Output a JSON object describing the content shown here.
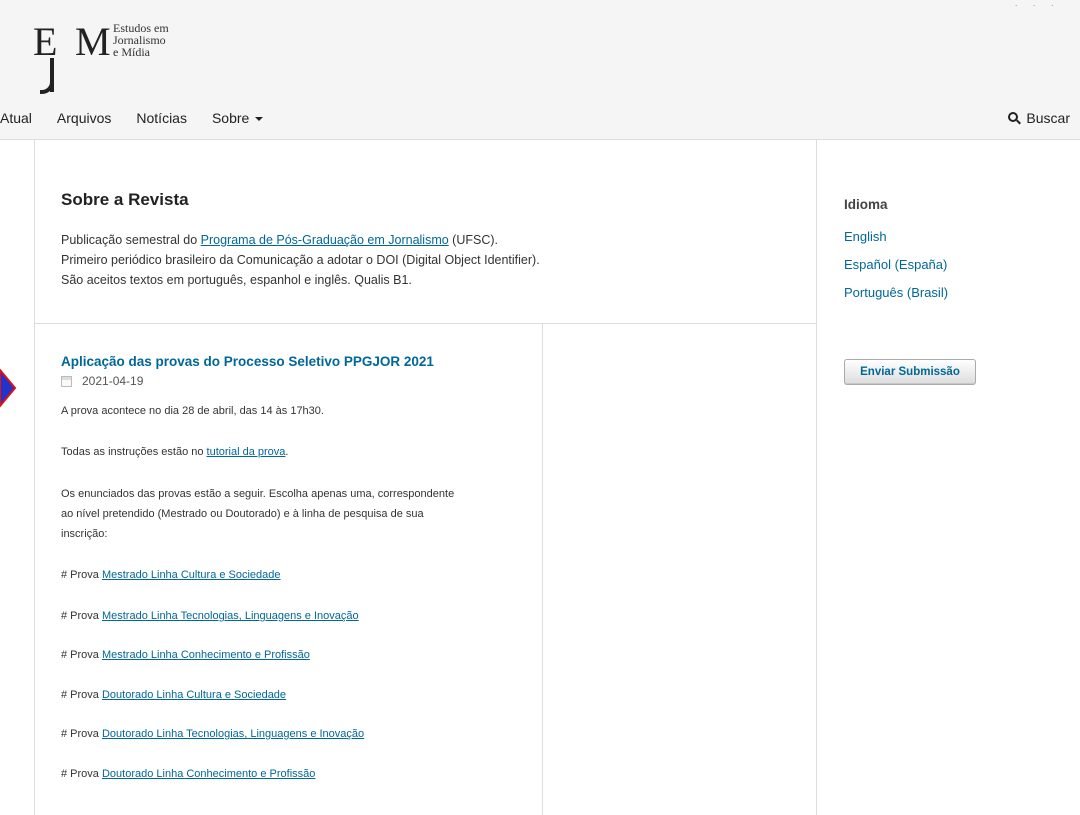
{
  "header": {
    "logo": {
      "mark": "EJM",
      "line1": "Estudos em",
      "line2": "Jornalismo",
      "line3": "e Mídia"
    },
    "nav": [
      {
        "label": "Atual"
      },
      {
        "label": "Arquivos"
      },
      {
        "label": "Notícias"
      },
      {
        "label": "Sobre"
      }
    ],
    "search_label": "Buscar"
  },
  "about": {
    "title": "Sobre a Revista",
    "line1_prefix": "Publicação semestral do ",
    "line1_link": "Programa de Pós-Graduação em Jornalismo",
    "line1_suffix": " (UFSC).",
    "line2": "Primeiro periódico brasileiro da Comunicação a adotar o DOI (Digital Object Identifier).",
    "line3": "São aceitos textos em português, espanhol e inglês. Qualis B1."
  },
  "news": {
    "title": "Aplicação das provas do Processo Seletivo PPGJOR 2021",
    "date": "2021-04-19",
    "p1": "A prova acontece no dia 28 de abril, das 14 às 17h30.",
    "p2_prefix": "Todas as instruções estão no ",
    "p2_link": "tutorial da prova",
    "p2_suffix": ".",
    "p3_line1": "Os enunciados das provas estão a seguir. Escolha apenas uma, correspondente",
    "p3_line2": "ao nível pretendido (Mestrado ou Doutorado) e à linha de pesquisa de sua",
    "p3_line3": "inscrição:",
    "prova_prefix": "# Prova ",
    "links": [
      "Mestrado Linha Cultura e Sociedade",
      "Mestrado Linha Tecnologias, Linguagens e Inovação",
      "Mestrado Linha Conhecimento e Profissão",
      "Doutorado Linha Cultura e Sociedade",
      "Doutorado Linha Tecnologias, Linguagens e Inovação",
      "Doutorado Linha Conhecimento e Profissão"
    ]
  },
  "sidebar": {
    "language_heading": "Idioma",
    "languages": [
      "English",
      "Español (España)",
      "Português (Brasil)"
    ],
    "submit_label": "Enviar Submissão"
  },
  "colors": {
    "link": "#006798",
    "header_bg": "#f5f5f5",
    "arrow": "#2233cc"
  }
}
